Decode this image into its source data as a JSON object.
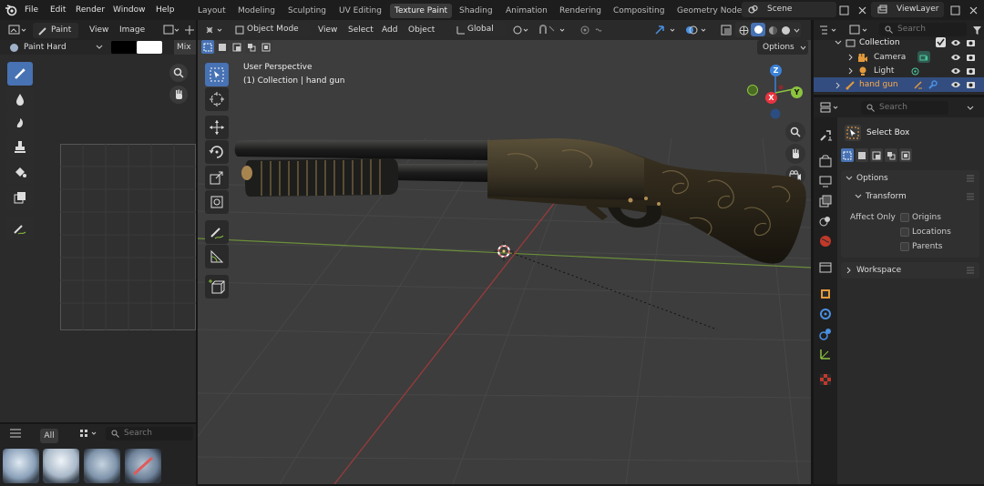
{
  "menubar": {
    "items": [
      "File",
      "Edit",
      "Render",
      "Window",
      "Help"
    ]
  },
  "workspaces": {
    "tabs": [
      "Layout",
      "Modeling",
      "Sculpting",
      "UV Editing",
      "Texture Paint",
      "Shading",
      "Animation",
      "Rendering",
      "Compositing",
      "Geometry Node"
    ],
    "active": "Texture Paint"
  },
  "scene": {
    "name": "Scene",
    "view_layer": "ViewLayer"
  },
  "image_editor": {
    "mode": "Paint",
    "menus": [
      "View",
      "Image"
    ],
    "brush": "Paint Hard",
    "blend": "Mix"
  },
  "viewport": {
    "mode": "Object Mode",
    "menus": [
      "View",
      "Select",
      "Add",
      "Object"
    ],
    "orientation": "Global",
    "options": "Options",
    "perspective": "User Perspective",
    "collection_info": "(1) Collection | hand gun"
  },
  "outliner": {
    "search_placeholder": "Search",
    "items": [
      {
        "name": "Collection"
      },
      {
        "name": "Camera"
      },
      {
        "name": "Light"
      },
      {
        "name": "hand gun"
      }
    ]
  },
  "properties": {
    "search_placeholder": "Search",
    "tool": "Select Box",
    "options_label": "Options",
    "transform_label": "Transform",
    "affect_only": "Affect Only",
    "affect_items": [
      "Origins",
      "Locations",
      "Parents"
    ],
    "workspace_label": "Workspace"
  },
  "brushes": {
    "filter": "All",
    "search_placeholder": "Search"
  },
  "gizmo": {
    "x": "X",
    "y": "Y",
    "z": "Z"
  },
  "colors": {
    "accent": "#4772b3",
    "x_axis": "#e8343f",
    "y_axis": "#8bc43f",
    "z_axis": "#3b82d9",
    "selected_row": "#334d80"
  }
}
